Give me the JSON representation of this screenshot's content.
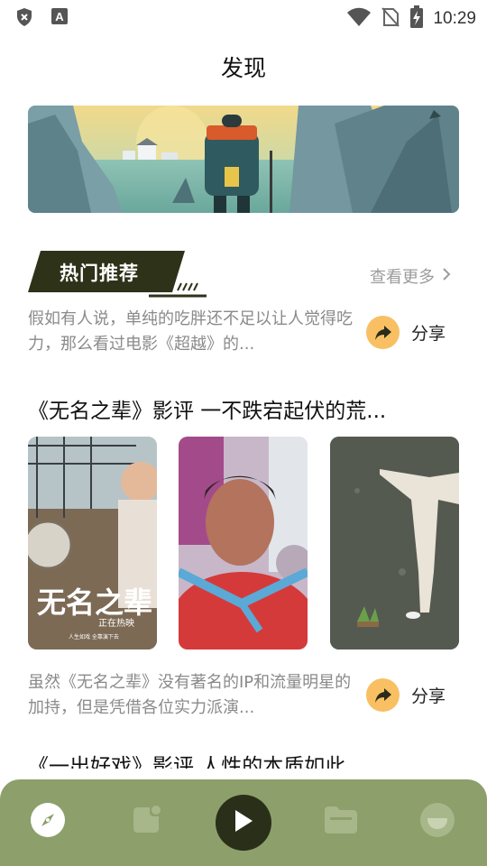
{
  "status_bar": {
    "time": "10:29",
    "left_icons": [
      "shield-x-icon",
      "font-a-icon"
    ],
    "right_icons": [
      "wifi-icon",
      "no-sim-icon",
      "battery-charging-icon"
    ]
  },
  "header": {
    "title": "发现"
  },
  "banner": {
    "image": "hiker-with-backpack-illustration"
  },
  "section": {
    "title": "热门推荐",
    "more_label": "查看更多",
    "more_icon": "chevron-right-icon"
  },
  "articles": [
    {
      "summary": "假如有人说，单纯的吃胖还不足以让人觉得吃力，那么看过电影《超越》的...",
      "share_label": "分享"
    },
    {
      "title": "《无名之辈》影评 一不跌宕起伏的荒...",
      "thumbnails": [
        {
          "caption": "无名之辈",
          "sub": "正在热映",
          "tag": "人生如戏 全靠演下去"
        },
        {
          "caption": ""
        },
        {
          "caption": ""
        }
      ],
      "summary": "虽然《无名之辈》没有著名的IP和流量明星的加持，但是凭借各位实力派演...",
      "share_label": "分享"
    },
    {
      "title": "《一出好戏》影评 人性的本质如此"
    }
  ],
  "bottom_nav": {
    "items": [
      "compass-icon",
      "notes-icon",
      "play-icon",
      "folder-icon",
      "smile-icon"
    ],
    "active": "compass-icon"
  },
  "colors": {
    "accent_dark": "#2e3219",
    "nav_bg": "#8d9f6b",
    "share_circle": "#f8c063"
  }
}
